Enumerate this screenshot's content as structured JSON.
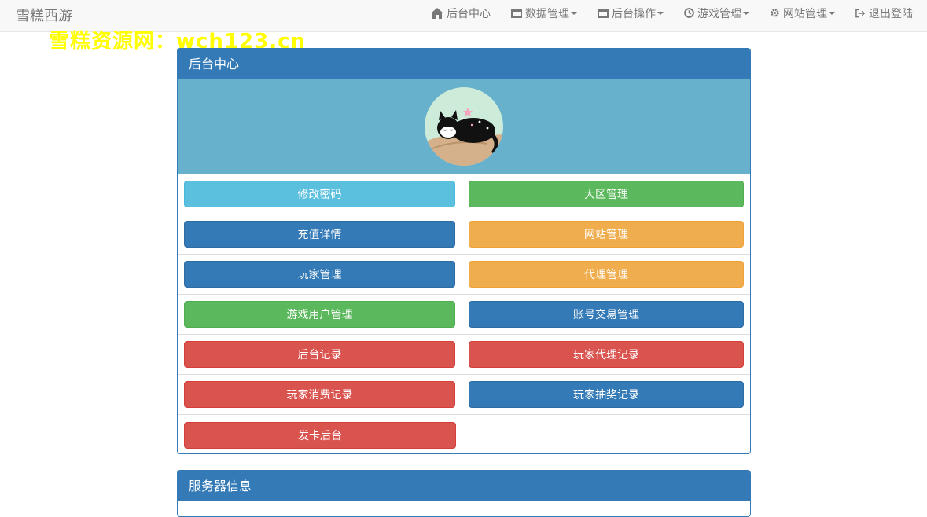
{
  "navbar": {
    "brand": "雪糕西游",
    "items": [
      {
        "label": "后台中心",
        "icon": "home-icon",
        "dropdown": false
      },
      {
        "label": "数据管理",
        "icon": "window-icon",
        "dropdown": true
      },
      {
        "label": "后台操作",
        "icon": "window-icon",
        "dropdown": true
      },
      {
        "label": "游戏管理",
        "icon": "clock-icon",
        "dropdown": true
      },
      {
        "label": "网站管理",
        "icon": "gear-icon",
        "dropdown": true
      },
      {
        "label": "退出登陆",
        "icon": "logout-icon",
        "dropdown": false
      }
    ]
  },
  "watermark": "雪糕资源网：wch123.cn",
  "main_panel": {
    "title": "后台中心",
    "buttons": [
      {
        "label": "修改密码",
        "style": "info"
      },
      {
        "label": "大区管理",
        "style": "success"
      },
      {
        "label": "充值详情",
        "style": "primary"
      },
      {
        "label": "网站管理",
        "style": "warning"
      },
      {
        "label": "玩家管理",
        "style": "primary"
      },
      {
        "label": "代理管理",
        "style": "warning"
      },
      {
        "label": "游戏用户管理",
        "style": "success"
      },
      {
        "label": "账号交易管理",
        "style": "primary"
      },
      {
        "label": "后台记录",
        "style": "danger"
      },
      {
        "label": "玩家代理记录",
        "style": "danger"
      },
      {
        "label": "玩家消费记录",
        "style": "danger"
      },
      {
        "label": "玩家抽奖记录",
        "style": "primary"
      },
      {
        "label": "发卡后台",
        "style": "danger"
      }
    ]
  },
  "server_panel": {
    "title": "服务器信息"
  },
  "colors": {
    "primary": "#337ab7",
    "info": "#5bc0de",
    "success": "#5cb85c",
    "warning": "#f0ad4e",
    "danger": "#d9534f",
    "watermark": "#ffff00"
  }
}
